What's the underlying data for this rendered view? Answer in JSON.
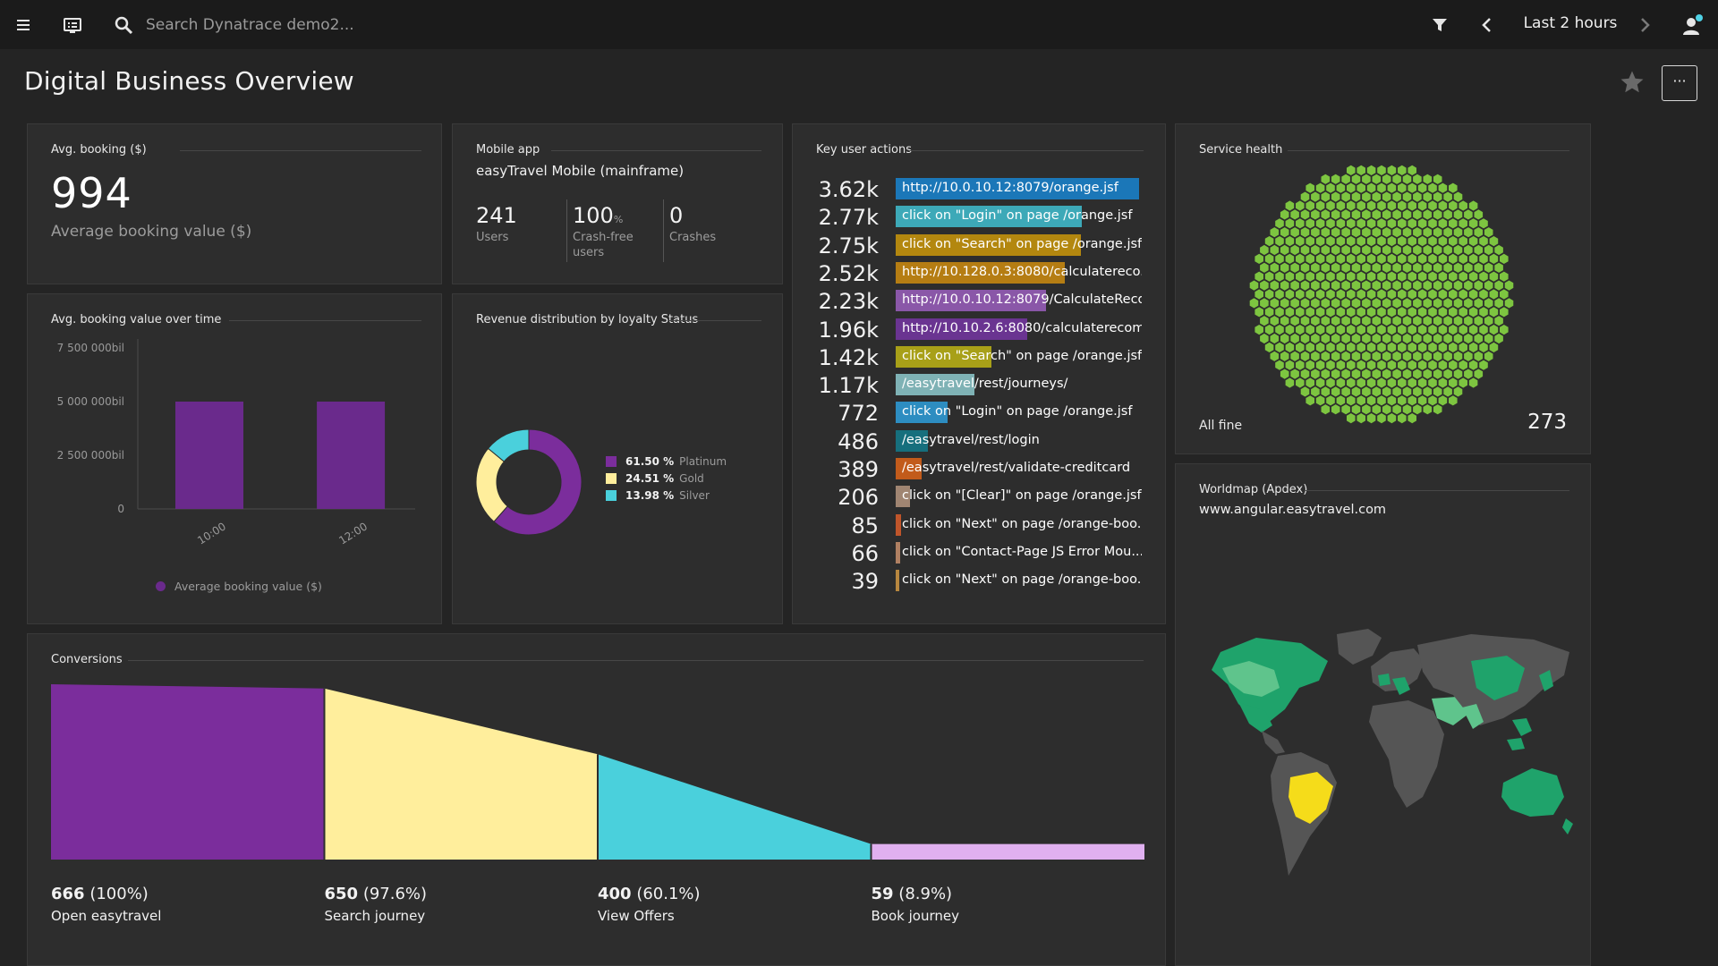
{
  "topbar": {
    "search_placeholder": "Search Dynatrace demo2...",
    "timeframe": "Last 2 hours"
  },
  "page": {
    "title": "Digital Business Overview"
  },
  "avg_booking": {
    "title": "Avg. booking ($)",
    "value": "994",
    "label": "Average booking value ($)"
  },
  "mobile_app": {
    "title": "Mobile app",
    "app_name": "easyTravel Mobile (mainframe)",
    "users_value": "241",
    "users_label": "Users",
    "crashfree_value": "100",
    "crashfree_unit": "%",
    "crashfree_label_1": "Crash-free",
    "crashfree_label_2": "users",
    "crashes_value": "0",
    "crashes_label": "Crashes"
  },
  "key_user_actions": {
    "title": "Key user actions",
    "rows": [
      {
        "count": "3.62k",
        "label": "http://10.0.10.12:8079/orange.jsf",
        "fill": 1.0,
        "color": "#1b77b8"
      },
      {
        "count": "2.77k",
        "label": "click on \"Login\" on page /orange.jsf",
        "fill": 0.765,
        "color": "#3da9b8"
      },
      {
        "count": "2.75k",
        "label": "click on \"Search\" on page /orange.jsf",
        "fill": 0.76,
        "color": "#b3870f"
      },
      {
        "count": "2.52k",
        "label": "http://10.128.0.3:8080/calculatereco...",
        "fill": 0.696,
        "color": "#b57d13"
      },
      {
        "count": "2.23k",
        "label": "http://10.0.10.12:8079/CalculateReco...",
        "fill": 0.616,
        "color": "#8a57a8"
      },
      {
        "count": "1.96k",
        "label": "http://10.10.2.6:8080/calculaterecom...",
        "fill": 0.541,
        "color": "#6a3491"
      },
      {
        "count": "1.42k",
        "label": "click on \"Search\" on page /orange.jsf",
        "fill": 0.392,
        "color": "#a8a018"
      },
      {
        "count": "1.17k",
        "label": "/easytravel/rest/journeys/",
        "fill": 0.323,
        "color": "#7fb2b5"
      },
      {
        "count": "772",
        "label": "click on \"Login\" on page /orange.jsf",
        "fill": 0.213,
        "color": "#2d8dc1"
      },
      {
        "count": "486",
        "label": "/easytravel/rest/login",
        "fill": 0.134,
        "color": "#166f7d"
      },
      {
        "count": "389",
        "label": "/easytravel/rest/validate-creditcard",
        "fill": 0.107,
        "color": "#c25b1b"
      },
      {
        "count": "206",
        "label": "click on \"[Clear]\" on page /orange.jsf",
        "fill": 0.057,
        "color": "#a08572"
      },
      {
        "count": "85",
        "label": "click on \"Next\" on page /orange-boo...",
        "fill": 0.023,
        "color": "#c0552a"
      },
      {
        "count": "66",
        "label": "click on \"Contact-Page JS Error Mou...",
        "fill": 0.018,
        "color": "#b08062"
      },
      {
        "count": "39",
        "label": "click on \"Next\" on page /orange-boo...",
        "fill": 0.011,
        "color": "#b8873f"
      }
    ]
  },
  "service_health": {
    "title": "Service health",
    "status": "All fine",
    "count": "273"
  },
  "avg_booking_chart": {
    "title": "Avg. booking value over time",
    "legend": "Average booking value ($)"
  },
  "revenue": {
    "title": "Revenue distribution by loyalty Status",
    "legend": [
      {
        "pct": "61.50 %",
        "name": "Platinum",
        "color": "#7b2d9c"
      },
      {
        "pct": "24.51 %",
        "name": "Gold",
        "color": "#ffee9c"
      },
      {
        "pct": "13.98 %",
        "name": "Silver",
        "color": "#4ad0dc"
      }
    ]
  },
  "worldmap": {
    "title": "Worldmap (Apdex)",
    "domain": "www.angular.easytravel.com"
  },
  "conversions": {
    "title": "Conversions",
    "steps": [
      {
        "count": "666",
        "pct": "(100%)",
        "name": "Open easytravel"
      },
      {
        "count": "650",
        "pct": "(97.6%)",
        "name": "Search journey"
      },
      {
        "count": "400",
        "pct": "(60.1%)",
        "name": "View Offers"
      },
      {
        "count": "59",
        "pct": "(8.9%)",
        "name": "Book journey"
      }
    ]
  },
  "chart_data": [
    {
      "type": "bar",
      "title": "Avg. booking value over time",
      "categories": [
        "10:00",
        "12:00"
      ],
      "series": [
        {
          "name": "Average booking value ($)",
          "values": [
            5000000000,
            5000000000
          ],
          "color": "#6a2a8c"
        }
      ],
      "yticks": [
        "0",
        "2 500 000bil",
        "5 000 000bil",
        "7 500 000bil"
      ],
      "ylim": [
        0,
        7500000000
      ],
      "legend_position": "bottom"
    },
    {
      "type": "pie",
      "title": "Revenue distribution by loyalty Status",
      "donut": true,
      "labels": [
        "Platinum",
        "Gold",
        "Silver"
      ],
      "values": [
        61.5,
        24.51,
        13.98
      ],
      "colors": [
        "#7b2d9c",
        "#ffee9c",
        "#4ad0dc"
      ],
      "legend_position": "right"
    },
    {
      "type": "area",
      "title": "Conversions",
      "categories": [
        "Open easytravel",
        "Search journey",
        "View Offers",
        "Book journey"
      ],
      "values": [
        666,
        650,
        400,
        59
      ],
      "colors": [
        "#7b2d9c",
        "#ffee9c",
        "#4ad0dc",
        "#e0b0f0"
      ]
    }
  ]
}
